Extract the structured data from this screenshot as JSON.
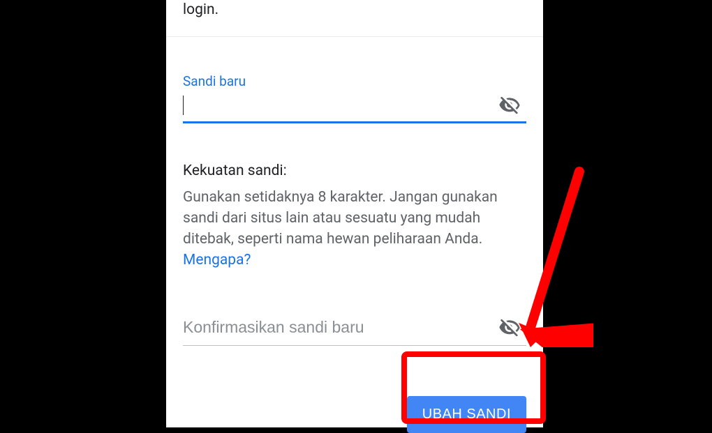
{
  "intro_tail": "login.",
  "newPassword": {
    "label": "Sandi baru",
    "value": ""
  },
  "strength": {
    "title": "Kekuatan sandi:",
    "description": "Gunakan setidaknya 8 karakter. Jangan gunakan sandi dari situs lain atau sesuatu yang mudah ditebak, seperti nama hewan peliharaan Anda. ",
    "whyLink": "Mengapa?"
  },
  "confirmPassword": {
    "placeholder": "Konfirmasikan sandi baru",
    "value": ""
  },
  "submitButton": "UBAH SANDI",
  "colors": {
    "accent": "#1a73e8",
    "button": "#4285f4",
    "annotation": "#ff0000"
  }
}
